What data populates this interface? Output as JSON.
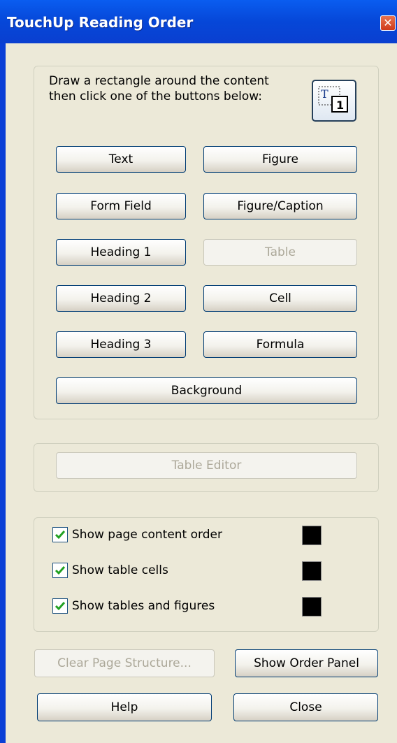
{
  "window": {
    "title": "TouchUp Reading Order",
    "close_glyph": "✕"
  },
  "instructions": "Draw a rectangle around the content then click one of the buttons below:",
  "draw_tool": {
    "icon": "touchup-reading-order-icon",
    "letter": "T",
    "number": "1"
  },
  "tag_buttons": {
    "text": "Text",
    "figure": "Figure",
    "form_field": "Form Field",
    "figure_caption": "Figure/Caption",
    "heading1": "Heading 1",
    "table": "Table",
    "heading2": "Heading 2",
    "cell": "Cell",
    "heading3": "Heading 3",
    "formula": "Formula",
    "background": "Background"
  },
  "table_editor": "Table Editor",
  "options": [
    {
      "label": "Show page content order",
      "checked": true,
      "color": "#000000"
    },
    {
      "label": "Show table cells",
      "checked": true,
      "color": "#000000"
    },
    {
      "label": "Show tables and figures",
      "checked": true,
      "color": "#000000"
    }
  ],
  "clear_page_structure": "Clear Page Structure...",
  "show_order_panel": "Show Order Panel",
  "help": "Help",
  "close": "Close"
}
